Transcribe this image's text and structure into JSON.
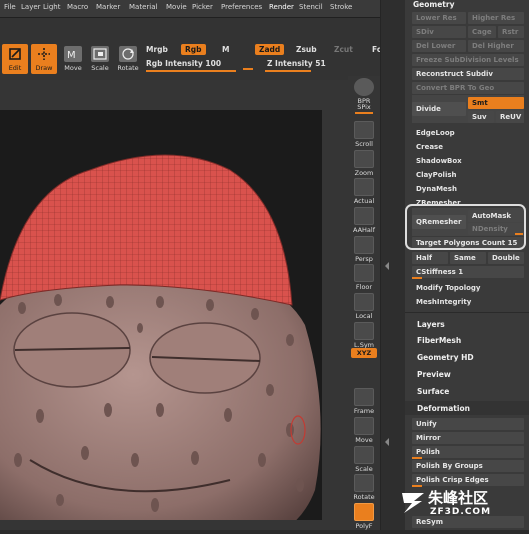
{
  "menu": [
    "File",
    "Layer",
    "Light",
    "Macro",
    "Marker",
    "Material",
    "Movie",
    "Picker",
    "Preferences",
    "Render",
    "Stencil",
    "Stroke"
  ],
  "toolbar": {
    "edit": "Edit",
    "draw": "Draw",
    "move": "Move",
    "scale": "Scale",
    "rotate": "Rotate",
    "mrgb": "Mrgb",
    "rgb": "Rgb",
    "m": "M",
    "zadd": "Zadd",
    "zsub": "Zsub",
    "zcut": "Zcut",
    "fo": "Fo",
    "rgb_intensity": "Rgb Intensity 100",
    "z_intensity": "Z Intensity 51",
    "mrgb_letters": "M"
  },
  "icons": {
    "bpr": "BPR",
    "spix": "SPix",
    "scroll": "Scroll",
    "zoom": "Zoom",
    "actual": "Actual",
    "aahalf": "AAHalf",
    "persp": "Persp",
    "floor": "Floor",
    "local": "Local",
    "lsym": "L.Sym",
    "xyz": "XYZ",
    "frame": "Frame",
    "move": "Move",
    "scale": "Scale",
    "rotate": "Rotate",
    "polyf": "PolyF"
  },
  "palette": {
    "geometry": "Geometry",
    "lower_res": "Lower Res",
    "higher_res": "Higher Res",
    "sdiv": "SDiv",
    "cage": "Cage",
    "rstr": "Rstr",
    "del_lower": "Del Lower",
    "del_higher": "Del Higher",
    "freeze": "Freeze SubDivision Levels",
    "reconstruct": "Reconstruct Subdiv",
    "convert_bpr": "Convert BPR To Geo",
    "divide": "Divide",
    "smt": "Smt",
    "suv": "Suv",
    "reuv": "ReUV",
    "edgeloop": "EdgeLoop",
    "crease": "Crease",
    "shadowbox": "ShadowBox",
    "claypolish": "ClayPolish",
    "dynamesh": "DynaMesh",
    "zremesher": "ZRemesher",
    "qremesher": "QRemesher",
    "automask": "AutoMask",
    "ndensity": "NDensity",
    "target_polygons": "Target Polygons Count 15",
    "half": "Half",
    "same": "Same",
    "double": "Double",
    "cstiffness": "CStiffness 1",
    "modify_topology": "Modify Topology",
    "meshintegrity": "MeshIntegrity",
    "layers": "Layers",
    "fibermesh": "FiberMesh",
    "geometry_hd": "Geometry HD",
    "preview": "Preview",
    "surface": "Surface",
    "deformation": "Deformation",
    "unify": "Unify",
    "mirror": "Mirror",
    "polish": "Polish",
    "polish_by_groups": "Polish By Groups",
    "polish_crisp": "Polish Crisp Edges",
    "resym": "ReSym"
  },
  "watermark": {
    "brand": "朱峰社区",
    "url": "ZF3D.COM"
  },
  "colors": {
    "accent": "#ea7f1e",
    "hat": "#d9524d",
    "body": "#9c7d78",
    "canvas": "#1b1b1b"
  }
}
